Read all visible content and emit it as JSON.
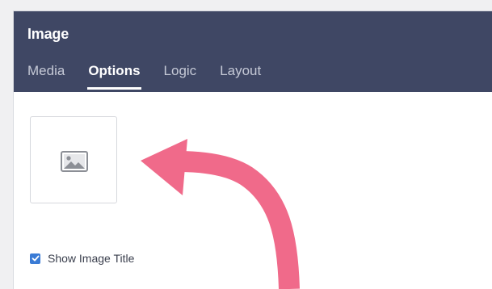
{
  "header": {
    "title": "Image"
  },
  "tabs": [
    {
      "label": "Media",
      "active": false
    },
    {
      "label": "Options",
      "active": true
    },
    {
      "label": "Logic",
      "active": false
    },
    {
      "label": "Layout",
      "active": false
    }
  ],
  "options": {
    "thumbnail_icon": "image-placeholder-icon",
    "show_title_label": "Show Image Title",
    "show_title_checked": true
  },
  "annotation": {
    "arrow_color": "#f06a8a",
    "arrow_icon": "curved-arrow-pointer"
  },
  "colors": {
    "header_bg": "#3f4764",
    "accent": "#3a7bd5"
  }
}
